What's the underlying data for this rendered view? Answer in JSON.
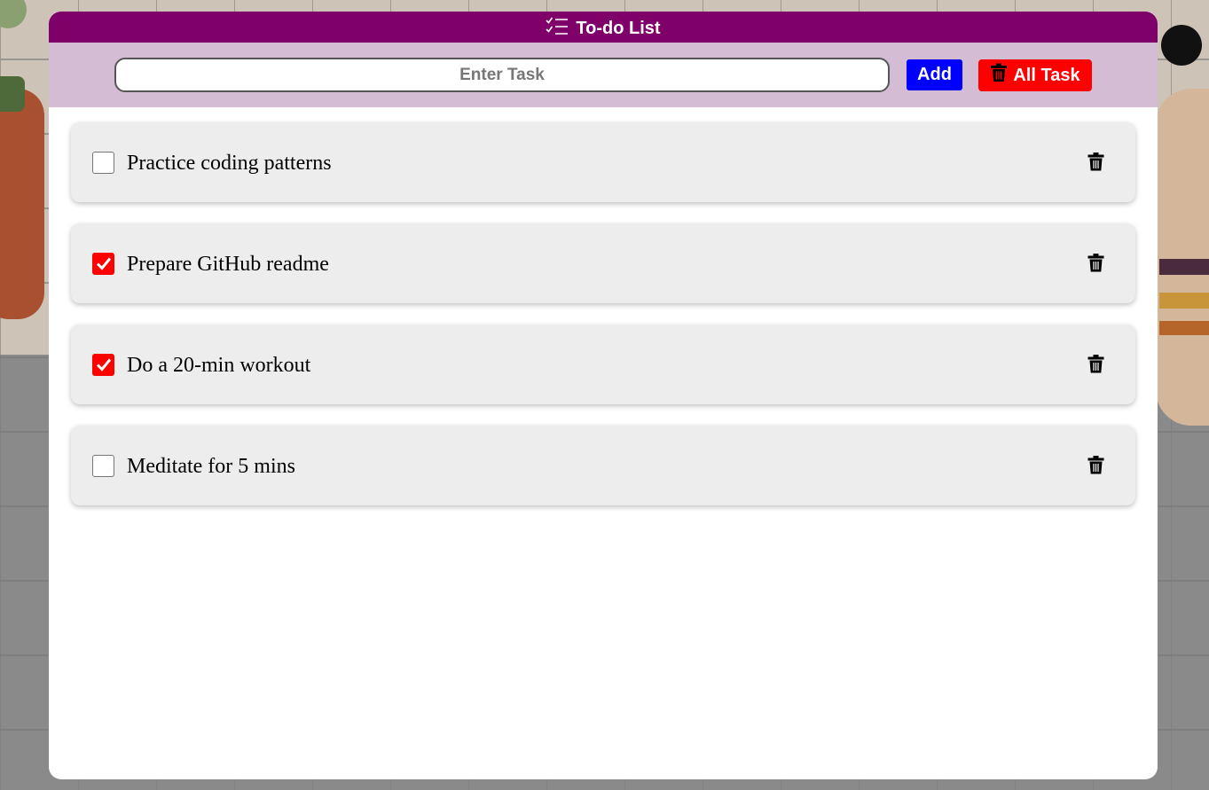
{
  "app": {
    "title": "To-do List",
    "title_icon": "checklist-icon"
  },
  "input_bar": {
    "task_input_placeholder": "Enter Task",
    "task_input_value": "",
    "add_label": "Add",
    "clear_all_label": "All Task",
    "clear_all_icon": "trash-icon"
  },
  "tasks": [
    {
      "text": "Practice coding patterns",
      "done": false
    },
    {
      "text": "Prepare GitHub readme",
      "done": true
    },
    {
      "text": "Do a 20-min workout",
      "done": true
    },
    {
      "text": "Meditate for 5 mins",
      "done": false
    }
  ],
  "colors": {
    "title_bar": "#800069",
    "input_bar": "#d5bcd5",
    "add_button": "#0000ff",
    "clear_all_button": "#ff0000",
    "checked": "#ff0000"
  }
}
